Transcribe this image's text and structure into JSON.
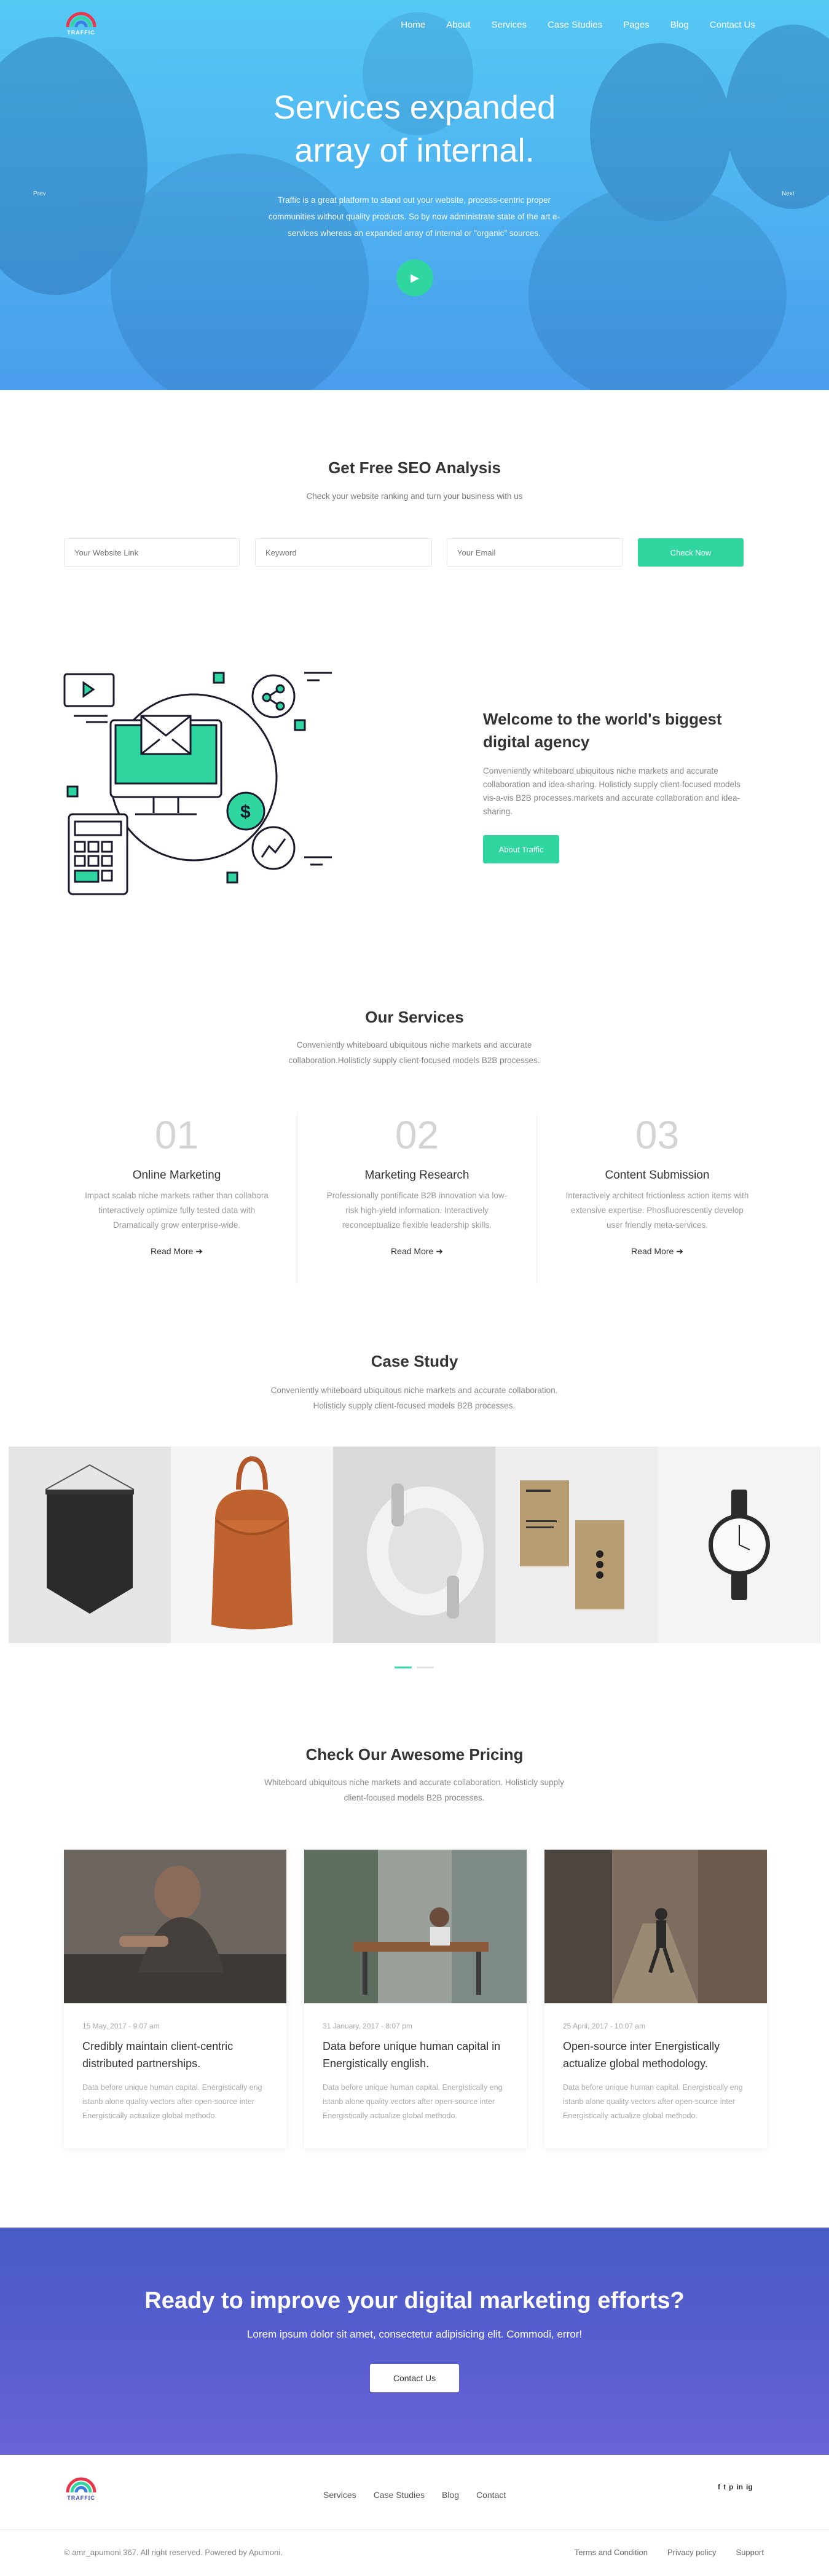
{
  "brand": {
    "name": "TRAFFIC"
  },
  "nav": {
    "items": [
      "Home",
      "About",
      "Services",
      "Case Studies",
      "Pages",
      "Blog",
      "Contact Us"
    ]
  },
  "hero": {
    "title_line1": "Services expanded",
    "title_line2": "array of internal.",
    "text": "Traffic is a great platform to stand out your website, process-centric proper communities without quality products. So by now administrate state of the art e-services whereas an expanded array of internal or \"organic\" sources.",
    "prev_label": "Prev",
    "next_label": "Next",
    "play_icon": "play-icon"
  },
  "seo": {
    "title": "Get Free SEO Analysis",
    "subtitle": "Check your website ranking and turn your business with us",
    "website_placeholder": "Your Website Link",
    "keyword_placeholder": "Keyword",
    "email_placeholder": "Your Email",
    "button": "Check Now"
  },
  "welcome": {
    "title": "Welcome to the world's biggest digital agency",
    "text": "Conveniently whiteboard ubiquitous niche markets and accurate collaboration and idea-sharing. Holisticly supply client-focused models vis-a-vis B2B processes.markets and accurate collaboration and idea-sharing.",
    "button": "About Traffic"
  },
  "services": {
    "title": "Our Services",
    "subtitle": "Conveniently whiteboard ubiquitous niche markets and accurate collaboration.Holisticly supply client-focused models B2B processes.",
    "items": [
      {
        "num": "01",
        "name": "Online Marketing",
        "desc": "Impact scalab niche markets rather than collabora tinteractively optimize fully tested data with Dramatically grow enterprise-wide.",
        "more": "Read More"
      },
      {
        "num": "02",
        "name": "Marketing Research",
        "desc": "Professionally pontificate B2B innovation via low-risk high-yield information. Interactively reconceptualize flexible leadership skills.",
        "more": "Read More"
      },
      {
        "num": "03",
        "name": "Content Submission",
        "desc": "Interactively architect frictionless action items with extensive expertise. Phosfluorescently develop user friendly meta-services.",
        "more": "Read More"
      }
    ]
  },
  "case_study": {
    "title": "Case Study",
    "subtitle": "Conveniently whiteboard ubiquitous niche markets and accurate collaboration. Holisticly supply client-focused models B2B processes."
  },
  "pricing": {
    "title": "Check Our Awesome Pricing",
    "subtitle": "Whiteboard ubiquitous niche markets and accurate collaboration. Holisticly supply client-focused models B2B processes.",
    "cards": [
      {
        "date": "15 May, 2017 - 9:07 am",
        "title": "Credibly maintain client-centric distributed partnerships.",
        "text": "Data before unique human capital. Energistically eng istanb alone quality vectors after open-source inter Energistically actualize global methodo."
      },
      {
        "date": "31 January, 2017 - 8:07 pm",
        "title": "Data before unique human capital in Energistically english.",
        "text": "Data before unique human capital. Energistically eng istanb alone quality vectors after open-source inter Energistically actualize global methodo."
      },
      {
        "date": "25 April, 2017 - 10:07 am",
        "title": "Open-source inter Energistically actualize global methodology.",
        "text": "Data before unique human capital. Energistically eng istanb alone quality vectors after open-source inter Energistically actualize global methodo."
      }
    ]
  },
  "cta": {
    "title": "Ready to improve your digital marketing efforts?",
    "text": "Lorem ipsum dolor sit amet, consectetur adipisicing elit. Commodi, error!",
    "button": "Contact Us"
  },
  "footer": {
    "links": [
      "Services",
      "Case Studies",
      "Blog",
      "Contact"
    ],
    "social": [
      "facebook-icon",
      "twitter-icon",
      "pinterest-icon",
      "linkedin-icon",
      "instagram-icon"
    ],
    "social_glyphs": [
      "f",
      "t",
      "p",
      "in",
      "ig"
    ],
    "copyright": "© amr_apumoni 367. All right reserved. Powered by Apumoni.",
    "legal": [
      "Terms and Condition",
      "Privacy policy",
      "Support"
    ]
  },
  "colors": {
    "accent": "#2fd6a0",
    "hero_blue": "#4fb3f0",
    "cta_purple": "#5a5ed1"
  }
}
